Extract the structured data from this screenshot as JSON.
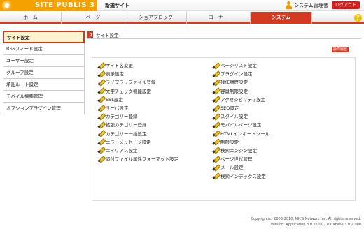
{
  "header": {
    "logo_text": "SITE PUBLIS 3",
    "site_name": "新規サイト",
    "user_name": "システム管理者",
    "logout_label": "ログアウト"
  },
  "nav": {
    "items": [
      "ホーム",
      "ページ",
      "ショアブロック",
      "コーナー",
      "システム"
    ],
    "active": "システム",
    "help_label": "?"
  },
  "sidebar": {
    "items": [
      "サイト設定",
      "RSSフィード設定",
      "ユーザー設定",
      "グループ設定",
      "承認ルート設定",
      "モバイル機種管理",
      "オプションプラグイン管理"
    ],
    "active_index": 0
  },
  "breadcrumb": {
    "label": "サイト設定"
  },
  "ops_link": {
    "label": "操作履歴"
  },
  "left_links": [
    "サイト名変更",
    "表示設定",
    "ライブラリファイル登録",
    "文字チェック機能設定",
    "SSL設定",
    "サーバ設定",
    "カテゴリー登録",
    "拡張カテゴリー登録",
    "カテゴリー一括設定",
    "エラーメッセージ設定",
    "エイリアス設定",
    "添付ファイル属性フォーマット設定"
  ],
  "right_links": [
    "ページリスト設定",
    "プラグイン設定",
    "操作履歴設定",
    "容量制限設定",
    "アクセシビリティ設定",
    "SEO設定",
    "スタイル設定",
    "モバイルページ設定",
    "HTMLインポートツール",
    "制限設定",
    "検索エンジン設定",
    "ページ世代管理",
    "メール設定",
    "検索インデックス設定"
  ],
  "footer": {
    "copyright": "Copyright(c) 2003-2010, MICS Network Inc. All rights reserved.",
    "version": "Version: Application 3.0.2 000  /  Database 3.0.2 000"
  },
  "colors": {
    "accent": "#d43a22",
    "brand": "#f5a200",
    "active_bg": "#fff5cc"
  }
}
